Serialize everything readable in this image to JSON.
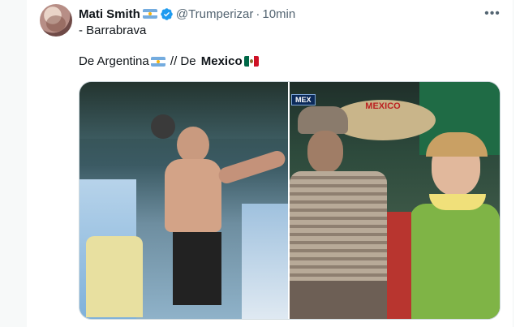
{
  "author": {
    "name": "Mati Smith",
    "handle": "@Trumperizar",
    "separator": "·",
    "time": "10min",
    "subline": "- Barrabrava"
  },
  "tweet": {
    "text_part1": "De Argentina",
    "text_part2": " // De ",
    "text_bold": "Mexico"
  },
  "icons": {
    "verified": "verified-badge-icon",
    "more": "more-options-icon",
    "flag_argentina": "argentina-flag-emoji",
    "flag_mexico": "mexico-flag-emoji"
  },
  "media": {
    "right_overlay_tag": "MEX",
    "hat_text": "MEXICO"
  },
  "colors": {
    "text": "#0f1419",
    "secondary": "#536471",
    "verified_blue": "#1d9bf0",
    "border": "#cfd9de"
  }
}
